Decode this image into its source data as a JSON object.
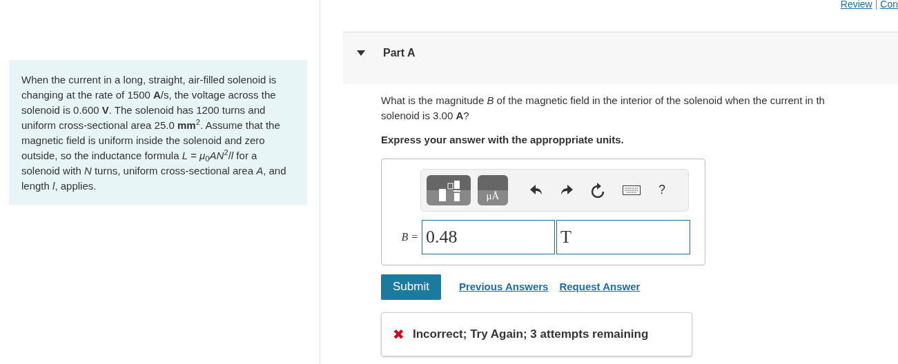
{
  "top_links": [
    "Review",
    "|",
    "Con"
  ],
  "problem": "When the current in a long, straight, air-filled solenoid is changing at the rate of 1500 **A**/s, the voltage across the solenoid is 0.600 **V**. The solenoid has 1200 turns and uniform cross-sectional area 25.0 **mm**$^{2}$. Assume that the magnetic field is uniform inside the solenoid and zero outside, so the inductance formula *L* = *μ*$_{0}$*AN*$^{2}$/*l* for a solenoid with *N* turns, uniform cross-sectional area *A*, and length *l*, applies.",
  "part": {
    "title": "Part A",
    "expanded": true
  },
  "question": [
    "What is the magnitude *B* of the magnetic field in the interior of the solenoid when the current in th",
    "solenoid is 3.00 **A**?"
  ],
  "instruction": "Express your answer with the approppriate units.",
  "toolbar": {
    "units_label": "μÅ",
    "help": "?"
  },
  "answer": {
    "label": "B =",
    "value": "0.48",
    "unit": "T"
  },
  "buttons": {
    "submit": "Submit",
    "previous": "Previous Answers",
    "request": "Request Answer"
  },
  "feedback": {
    "correct": false,
    "mark": "✖",
    "text": "Incorrect; Try Again; 3 attempts remaining"
  }
}
